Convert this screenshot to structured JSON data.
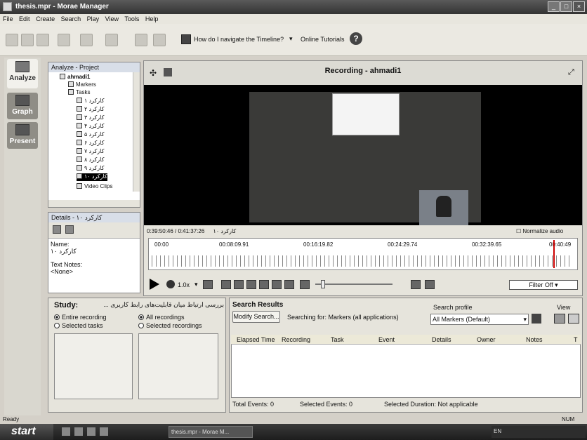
{
  "app": {
    "title": "thesis.mpr - Morae Manager"
  },
  "menu": [
    "File",
    "Edit",
    "Create",
    "Search",
    "Play",
    "View",
    "Tools",
    "Help"
  ],
  "toolbar": {
    "help_label": "How do I navigate the Timeline?",
    "online_tutorials": "Online Tutorials"
  },
  "nav": {
    "analyze": "Analyze",
    "graph": "Graph",
    "present": "Present"
  },
  "project": {
    "title": "Analyze - Project",
    "root": "ahmadi1",
    "markers": "Markers",
    "tasks_label": "Tasks",
    "tasks": [
      "کارکرد ۱",
      "کارکرد ۲",
      "کارکرد ۳",
      "کارکرد ۴",
      "کارکرد ۵",
      "کارکرد ۶",
      "کارکرد ۷",
      "کارکرد ۸",
      "کارکرد ۹",
      "کارکرد ۱۰"
    ],
    "video_clips": "Video Clips"
  },
  "details": {
    "title": "Details - کارکرد ۱۰",
    "name_label": "Name:",
    "name_value": "کارکرد ۱۰",
    "notes_label": "Text Notes:",
    "notes_value": "<None>"
  },
  "viewer": {
    "title": "Recording - ahmadi1",
    "time_info": "0:39:50:46 / 0:41:37:26",
    "task_label": "کارکرد ۱۰",
    "normalize": "Normalize audio",
    "timeline_labels": [
      "00:00",
      "00:08:09.91",
      "00:16:19.82",
      "00:24:29.74",
      "00:32:39.65",
      "00:40:49"
    ],
    "speed": "1.0x",
    "filter": "Filter Off"
  },
  "study": {
    "label": "Study:",
    "name": "بررسی ارتباط میان قابلیت‌های رابط کاربری ...",
    "entire_recording": "Entire recording",
    "selected_tasks": "Selected tasks",
    "all_recordings": "All recordings",
    "selected_recordings": "Selected recordings"
  },
  "search": {
    "title": "Search Results",
    "modify": "Modify Search...",
    "searching_for": "Searching for: Markers (all applications)",
    "profile_label": "Search profile",
    "profile_value": "All Markers (Default)",
    "view_label": "View",
    "columns": [
      "Elapsed Time",
      "Recording",
      "Task",
      "Event",
      "Details",
      "Owner",
      "Notes",
      "T"
    ],
    "total_events": "Total Events: 0",
    "selected_events": "Selected Events: 0",
    "selected_duration": "Selected Duration: Not applicable"
  },
  "status": {
    "left": "Ready",
    "right": "NUM"
  },
  "taskbar": {
    "start": "start",
    "item": "thesis.mpr - Morae M...",
    "tray": "EN"
  }
}
